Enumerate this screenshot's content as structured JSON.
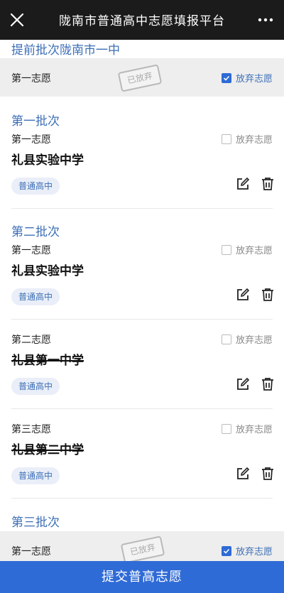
{
  "header": {
    "title": "陇南市普通高中志愿填报平台"
  },
  "early_batch": {
    "title": "提前批次陇南市一中",
    "row_label": "第一志愿",
    "stamp": "已放弃",
    "checkbox_label": "放弃志愿",
    "checked": true
  },
  "batch1": {
    "title": "第一批次",
    "choices": [
      {
        "label": "第一志愿",
        "school": "礼县实验中学",
        "tag": "普通高中",
        "checkbox_label": "放弃志愿"
      }
    ]
  },
  "batch2": {
    "title": "第二批次",
    "choices": [
      {
        "label": "第一志愿",
        "school": "礼县实验中学",
        "tag": "普通高中",
        "checkbox_label": "放弃志愿"
      },
      {
        "label": "第二志愿",
        "school": "礼县第一中学",
        "tag": "普通高中",
        "checkbox_label": "放弃志愿"
      },
      {
        "label": "第三志愿",
        "school": "礼县第二中学",
        "tag": "普通高中",
        "checkbox_label": "放弃志愿"
      }
    ]
  },
  "batch3": {
    "title": "第三批次",
    "row_label": "第一志愿",
    "stamp": "已放弃",
    "checkbox_label": "放弃志愿",
    "checked": true
  },
  "submit": {
    "label": "提交普高志愿"
  },
  "colors": {
    "accent": "#2f6bd6",
    "batch_title": "#3d6fb6",
    "header_bg": "#1b1b1b"
  }
}
